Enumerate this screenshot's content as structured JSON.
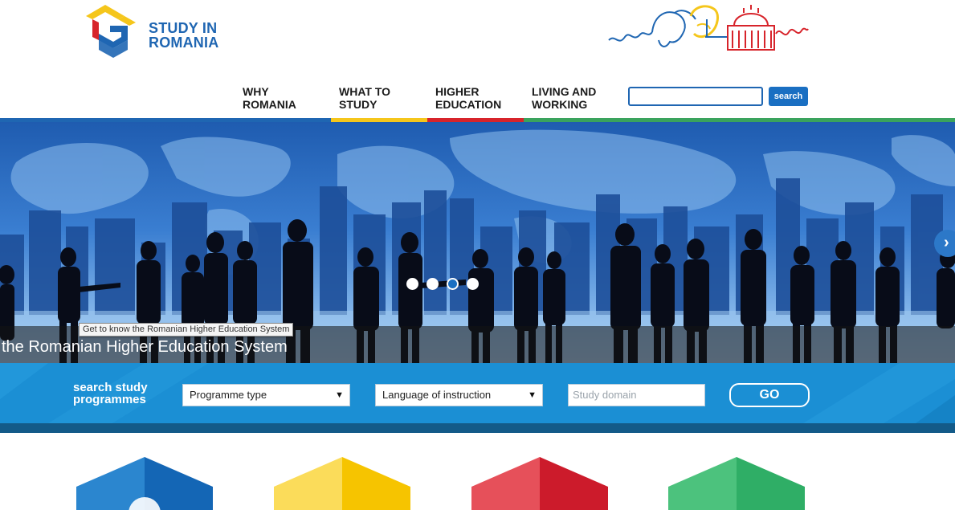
{
  "brand": {
    "logo_line1": "STUDY IN",
    "logo_line2": "ROMANIA",
    "colors": {
      "blue": "#1f66b2",
      "yellow": "#f5c61b",
      "red": "#d7242b",
      "green": "#3aa35d"
    }
  },
  "nav": {
    "items": [
      {
        "line1": "WHY",
        "line2": "ROMANIA"
      },
      {
        "line1": "WHAT TO",
        "line2": "STUDY"
      },
      {
        "line1": "HIGHER",
        "line2": "EDUCATION"
      },
      {
        "line1": "LIVING AND",
        "line2": "WORKING"
      }
    ]
  },
  "search": {
    "placeholder": "",
    "button_label": "search"
  },
  "hero": {
    "slide_count": 4,
    "active_slide": 3,
    "caption": "the Romanian Higher Education System",
    "tooltip": "Get to know the Romanian Higher Education System",
    "next_icon": "chevron-right-icon"
  },
  "study_search": {
    "title_line1": "search study",
    "title_line2": "programmes",
    "programme_type": "Programme type",
    "language": "Language of instruction",
    "domain_placeholder": "Study domain",
    "go_label": "GO",
    "caret": "▼"
  },
  "categories": [
    {
      "color_left": "#2b86cf",
      "color_right": "#1466b5"
    },
    {
      "color_left": "#fbdc5a",
      "color_right": "#f6c400"
    },
    {
      "color_left": "#e6505a",
      "color_right": "#cc1b2b"
    },
    {
      "color_left": "#4cc27d",
      "color_right": "#2fae66"
    }
  ]
}
